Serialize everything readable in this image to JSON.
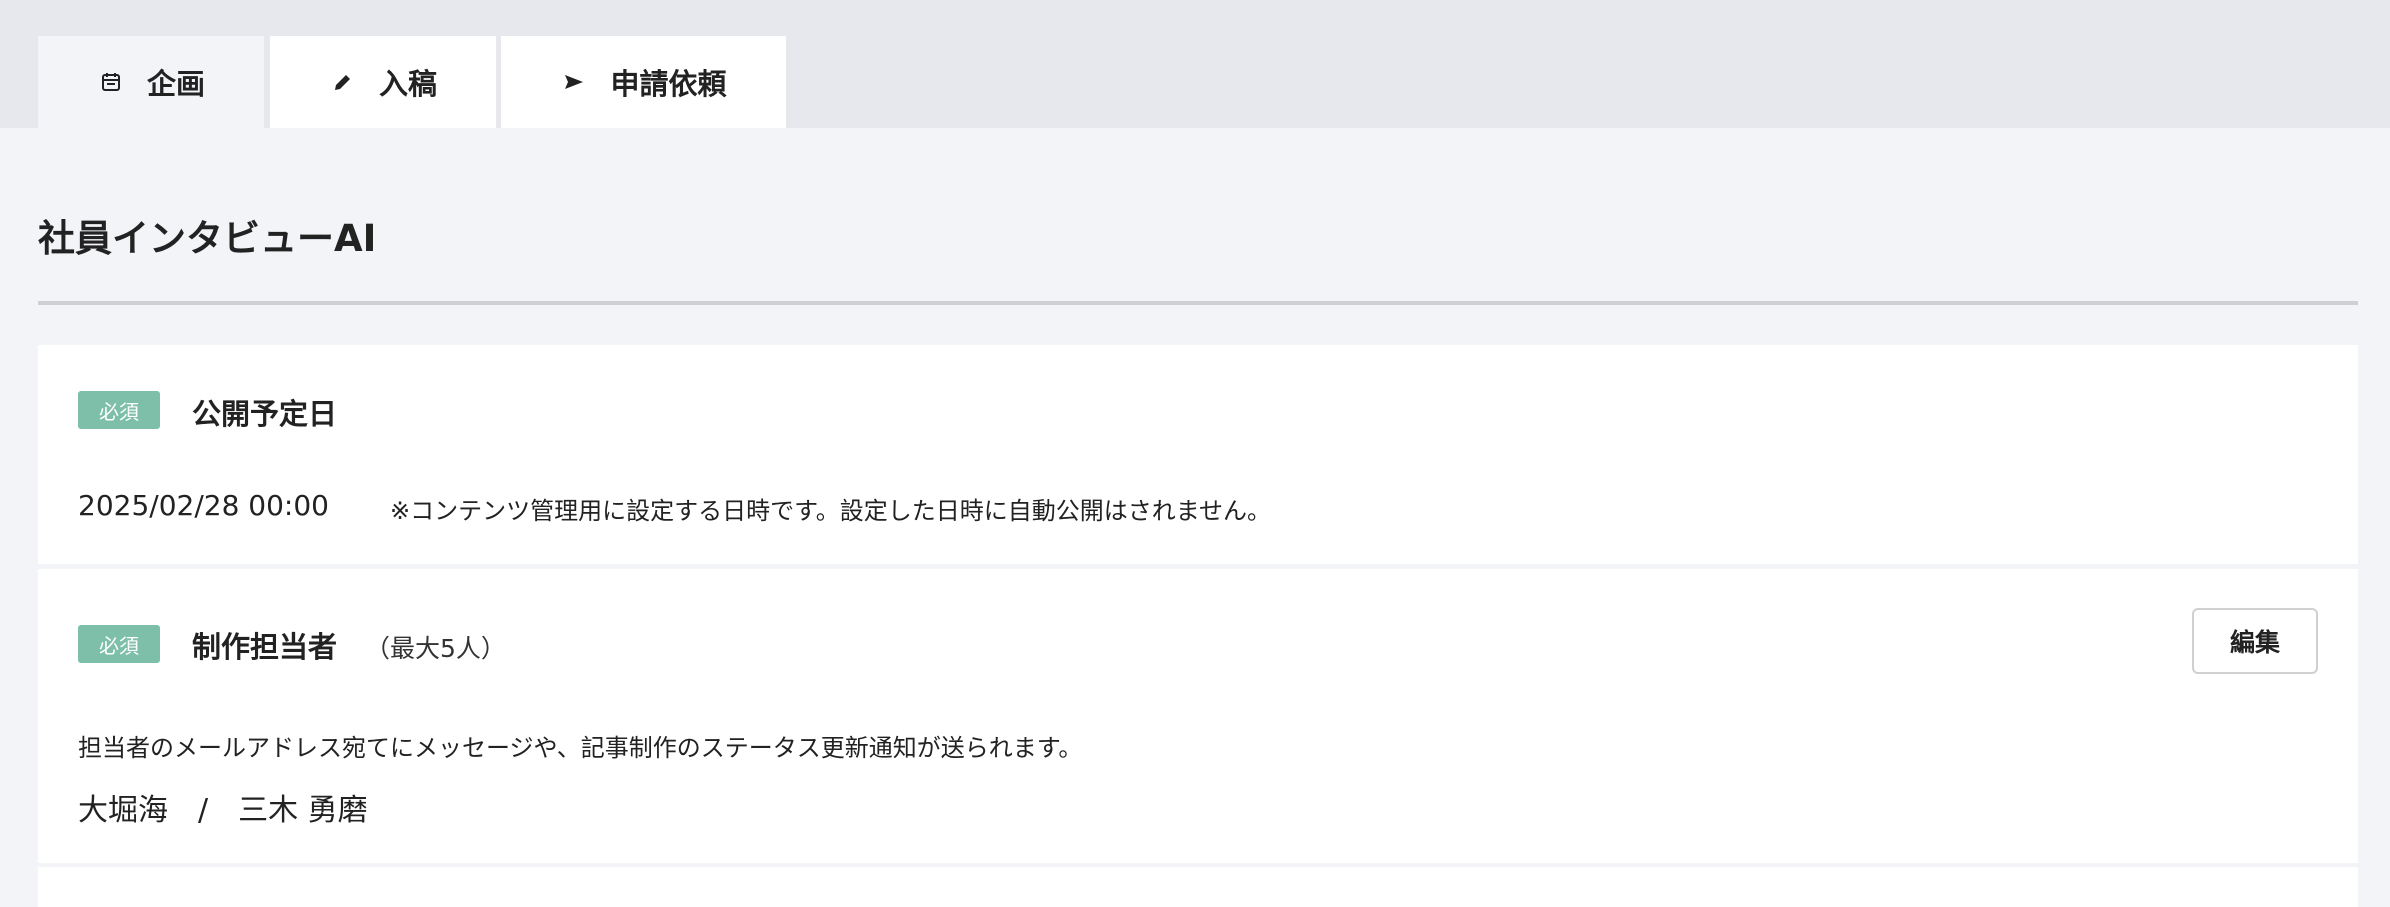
{
  "tabs": [
    {
      "label": "企画",
      "icon": "calendar-icon",
      "active": true
    },
    {
      "label": "入稿",
      "icon": "pencil-icon",
      "active": false
    },
    {
      "label": "申請依頼",
      "icon": "send-icon",
      "active": false
    }
  ],
  "page": {
    "title": "社員インタビューAI"
  },
  "publish_date": {
    "badge": "必須",
    "label": "公開予定日",
    "value": "2025/02/28 00:00",
    "note": "※コンテンツ管理用に設定する日時です。設定した日時に自動公開はされません。"
  },
  "assignees": {
    "badge": "必須",
    "label": "制作担当者",
    "sublabel": "（最大5人）",
    "edit_label": "編集",
    "description": "担当者のメールアドレス宛てにメッセージや、記事制作のステータス更新通知が送られます。",
    "people": [
      "大堀海",
      "三木 勇磨"
    ],
    "separator": "/"
  },
  "colors": {
    "badge": "#7dbfa9",
    "page_bg": "#f3f4f8",
    "tabbar_bg": "#e7e8ed"
  }
}
